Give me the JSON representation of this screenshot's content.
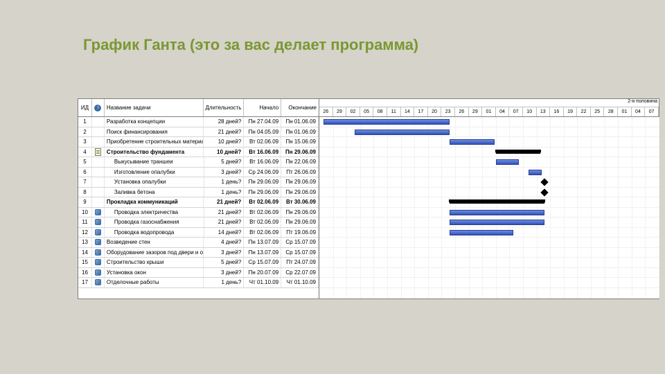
{
  "title": "График Ганта (это за вас делает программа)",
  "columns": {
    "id": "ИД",
    "info": "",
    "name": "Название задачи",
    "duration": "Длительность",
    "start": "Начало",
    "end": "Окончание"
  },
  "timeline": {
    "top_label": "2-я половина",
    "days": [
      "26",
      "29",
      "02",
      "05",
      "08",
      "11",
      "14",
      "17",
      "20",
      "23",
      "26",
      "29",
      "01",
      "04",
      "07",
      "10",
      "13",
      "16",
      "19",
      "22",
      "25",
      "28",
      "01",
      "04",
      "07"
    ]
  },
  "tasks": [
    {
      "id": "1",
      "icon": "",
      "name": "Разработка концепции",
      "dur": "28 дней?",
      "start": "Пн 27.04.09",
      "end": "Пн 01.06.09",
      "bold": false,
      "indent": 0
    },
    {
      "id": "2",
      "icon": "",
      "name": "Поиск финансирования",
      "dur": "21 дней?",
      "start": "Пн 04.05.09",
      "end": "Пн 01.06.09",
      "bold": false,
      "indent": 0
    },
    {
      "id": "3",
      "icon": "",
      "name": "Приобретение строительных материалов",
      "dur": "10 дней?",
      "start": "Вт 02.06.09",
      "end": "Пн 15.06.09",
      "bold": false,
      "indent": 0
    },
    {
      "id": "4",
      "icon": "note",
      "name": "Строительство фундамента",
      "dur": "10 дней?",
      "start": "Вт 16.06.09",
      "end": "Пн 29.06.09",
      "bold": true,
      "indent": 0
    },
    {
      "id": "5",
      "icon": "",
      "name": "Выкусывание траншеи",
      "dur": "5 дней?",
      "start": "Вт 16.06.09",
      "end": "Пн 22.06.09",
      "bold": false,
      "indent": 1
    },
    {
      "id": "6",
      "icon": "",
      "name": "Изготовление опалубки",
      "dur": "3 дней?",
      "start": "Ср 24.06.09",
      "end": "Пт 26.06.09",
      "bold": false,
      "indent": 1
    },
    {
      "id": "7",
      "icon": "",
      "name": "Установка опалубки",
      "dur": "1 день?",
      "start": "Пн 29.06.09",
      "end": "Пн 29.06.09",
      "bold": false,
      "indent": 1
    },
    {
      "id": "8",
      "icon": "",
      "name": "Заливка бетона",
      "dur": "1 день?",
      "start": "Пн 29.06.09",
      "end": "Пн 29.06.09",
      "bold": false,
      "indent": 1
    },
    {
      "id": "9",
      "icon": "",
      "name": "Прокладка коммуникаций",
      "dur": "21 дней?",
      "start": "Вт 02.06.09",
      "end": "Вт 30.06.09",
      "bold": true,
      "indent": 0
    },
    {
      "id": "10",
      "icon": "link",
      "name": "Проводка электричества",
      "dur": "21 дней?",
      "start": "Вт 02.06.09",
      "end": "Пн 29.06.09",
      "bold": false,
      "indent": 1
    },
    {
      "id": "11",
      "icon": "link",
      "name": "Проводка газоснабжения",
      "dur": "21 дней?",
      "start": "Вт 02.06.09",
      "end": "Пн 29.06.09",
      "bold": false,
      "indent": 1
    },
    {
      "id": "12",
      "icon": "link",
      "name": "Проводка водопровода",
      "dur": "14 дней?",
      "start": "Вт 02.06.09",
      "end": "Пт 19.06.09",
      "bold": false,
      "indent": 1
    },
    {
      "id": "13",
      "icon": "link",
      "name": "Возведение стен",
      "dur": "4 дней?",
      "start": "Пн 13.07.09",
      "end": "Ср 15.07.09",
      "bold": false,
      "indent": 0
    },
    {
      "id": "14",
      "icon": "link",
      "name": "Оборудование зазоров под двери и окна",
      "dur": "3 дней?",
      "start": "Пн 13.07.09",
      "end": "Ср 15.07.09",
      "bold": false,
      "indent": 0
    },
    {
      "id": "15",
      "icon": "link",
      "name": "Строительство крыши",
      "dur": "5 дней?",
      "start": "Ср 15.07.09",
      "end": "Пт 24.07.09",
      "bold": false,
      "indent": 0
    },
    {
      "id": "16",
      "icon": "link",
      "name": "Установка окон",
      "dur": "3 дней?",
      "start": "Пн 20.07.09",
      "end": "Ср 22.07.09",
      "bold": false,
      "indent": 0
    },
    {
      "id": "17",
      "icon": "link",
      "name": "Отделочные работы",
      "dur": "1 день?",
      "start": "Чт 01.10.09",
      "end": "Чт 01.10.09",
      "bold": false,
      "indent": 0
    }
  ],
  "chart_data": {
    "type": "gantt",
    "unit_days": 3,
    "start_index": 0,
    "bars": [
      {
        "row": 0,
        "type": "task",
        "start": 0.3,
        "span": 9.3
      },
      {
        "row": 1,
        "type": "task",
        "start": 2.6,
        "span": 7.0
      },
      {
        "row": 2,
        "type": "task",
        "start": 9.6,
        "span": 3.3
      },
      {
        "row": 3,
        "type": "summary",
        "start": 13.0,
        "span": 3.3
      },
      {
        "row": 4,
        "type": "task",
        "start": 13.0,
        "span": 1.7
      },
      {
        "row": 5,
        "type": "task",
        "start": 15.4,
        "span": 1.0
      },
      {
        "row": 6,
        "type": "milestone",
        "start": 16.4,
        "span": 0
      },
      {
        "row": 7,
        "type": "milestone",
        "start": 16.4,
        "span": 0
      },
      {
        "row": 8,
        "type": "summary",
        "start": 9.6,
        "span": 7.0
      },
      {
        "row": 9,
        "type": "task",
        "start": 9.6,
        "span": 7.0
      },
      {
        "row": 10,
        "type": "task",
        "start": 9.6,
        "span": 7.0
      },
      {
        "row": 11,
        "type": "task",
        "start": 9.6,
        "span": 4.7
      }
    ]
  }
}
